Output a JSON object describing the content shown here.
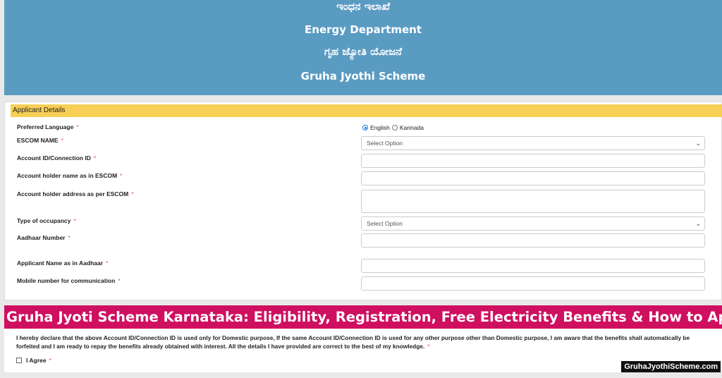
{
  "header": {
    "kannada_dept": "ಇಂಧನ ಇಲಾಖೆ",
    "dept": "Energy Department",
    "kannada_scheme": "ಗೃಹ ಜ್ಯೋತಿ ಯೋಜನೆ",
    "scheme": "Gruha Jyothi Scheme"
  },
  "form": {
    "section_title": "Applicant Details",
    "required_mark": "*",
    "preferred_language": {
      "label": "Preferred Language",
      "options": [
        "English",
        "Kannada"
      ],
      "selected": "English"
    },
    "escom": {
      "label": "ESCOM NAME",
      "value": "Select Option"
    },
    "account_id": {
      "label": "Account ID/Connection ID",
      "value": ""
    },
    "holder_name": {
      "label": "Account holder name as in ESCOM",
      "value": ""
    },
    "holder_address": {
      "label": "Account holder address as per ESCOM",
      "value": ""
    },
    "occupancy": {
      "label": "Type of occupancy",
      "value": "Select Option"
    },
    "aadhaar": {
      "label": "Aadhaar Number",
      "value": ""
    },
    "aadhaar_name": {
      "label": "Applicant Name as in Aadhaar",
      "value": ""
    },
    "mobile": {
      "label": "Mobile number for communication",
      "value": ""
    }
  },
  "banner": "Gruha Jyoti Scheme Karnataka: Eligibility, Registration, Free Electricity Benefits & How to Apply",
  "declaration": {
    "text": "I hereby declare that the above Account ID/Connection ID is used only for Domestic purpose, If the same Account ID/Connection ID is used for any other purpose other than Domestic purpose, I am aware that the benefits shall automatically be forfeited and I am ready to repay the benefits already obtained with interest. All the details I have provided are correct to the best of my knowledge.",
    "agree_label": "I Agree"
  },
  "watermark": "GruhaJyothiScheme.com"
}
